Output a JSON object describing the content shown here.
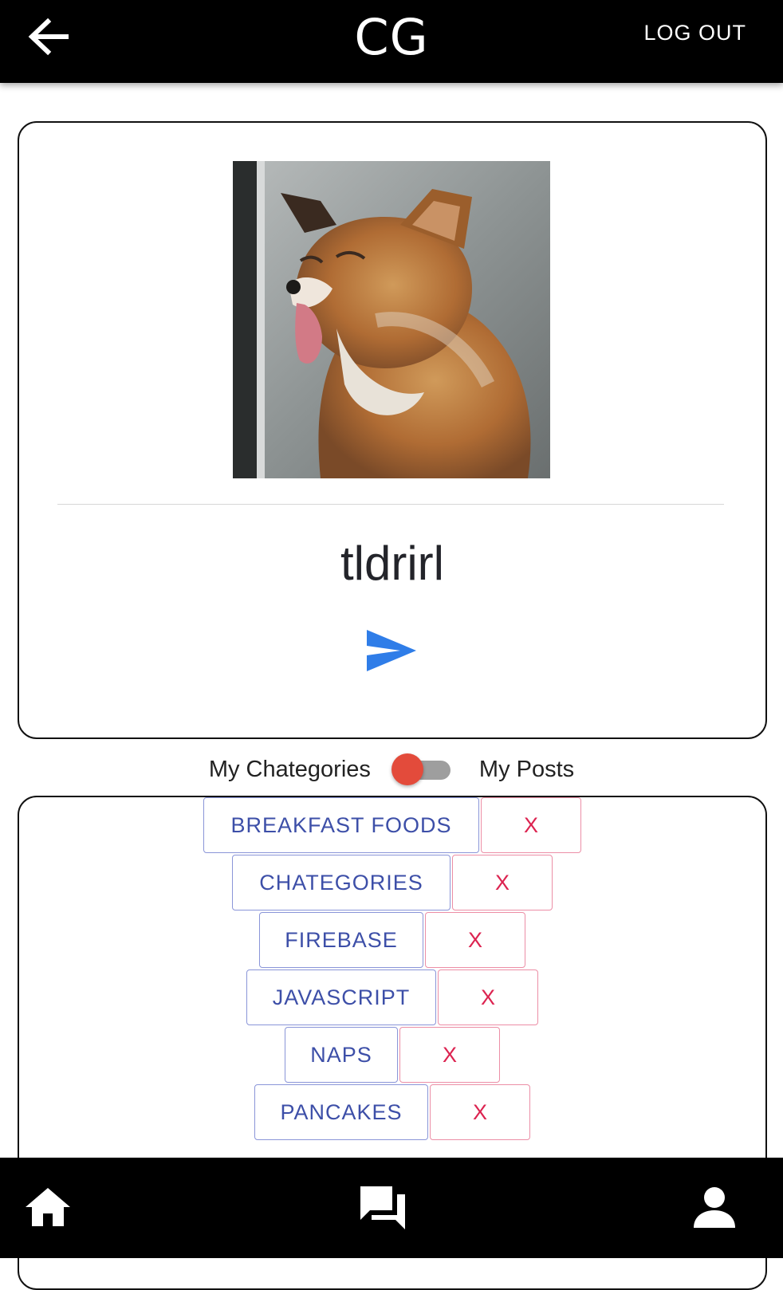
{
  "header": {
    "title": "CG",
    "back_icon": "arrow-left-icon",
    "logout_label": "LOG OUT"
  },
  "profile": {
    "username": "tldrirl",
    "avatar": "fox-photo",
    "send_icon": "send-icon"
  },
  "toggle": {
    "left_label": "My Chategories",
    "right_label": "My Posts",
    "checked": false,
    "thumb_color": "#e34b3b",
    "track_color": "#9e9e9e"
  },
  "categories": [
    {
      "label": "BREAKFAST FOODS",
      "delete_label": "X"
    },
    {
      "label": "CHATEGORIES",
      "delete_label": "X"
    },
    {
      "label": "FIREBASE",
      "delete_label": "X"
    },
    {
      "label": "JAVASCRIPT",
      "delete_label": "X"
    },
    {
      "label": "NAPS",
      "delete_label": "X"
    },
    {
      "label": "PANCAKES",
      "delete_label": "X"
    }
  ],
  "bottom_nav": {
    "items": [
      "home-icon",
      "chat-icon",
      "person-icon"
    ]
  },
  "colors": {
    "category_text": "#3d4fa8",
    "delete_text": "#dc2350",
    "send_blue": "#2f7de8"
  }
}
